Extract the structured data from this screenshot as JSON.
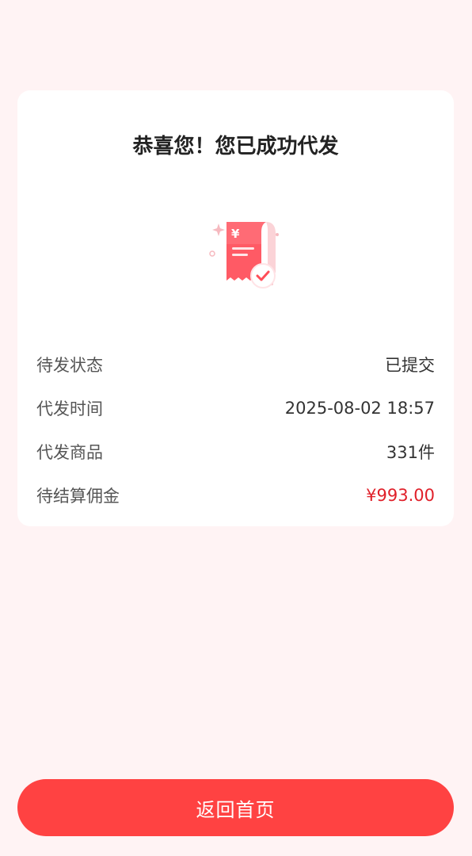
{
  "success_card": {
    "title": "恭喜您！您已成功代发",
    "illustration_icon": "receipt-check-icon",
    "rows": [
      {
        "label": "待发状态",
        "value": "已提交"
      },
      {
        "label": "代发时间",
        "value": "2025-08-02 18:57"
      },
      {
        "label": "代发商品",
        "value": "331件"
      },
      {
        "label": "待结算佣金",
        "value": "¥993.00"
      }
    ]
  },
  "footer": {
    "return_home_label": "返回首页"
  },
  "colors": {
    "accent": "#ff4242",
    "commission": "#e0202a",
    "background": "#fff3f4"
  }
}
